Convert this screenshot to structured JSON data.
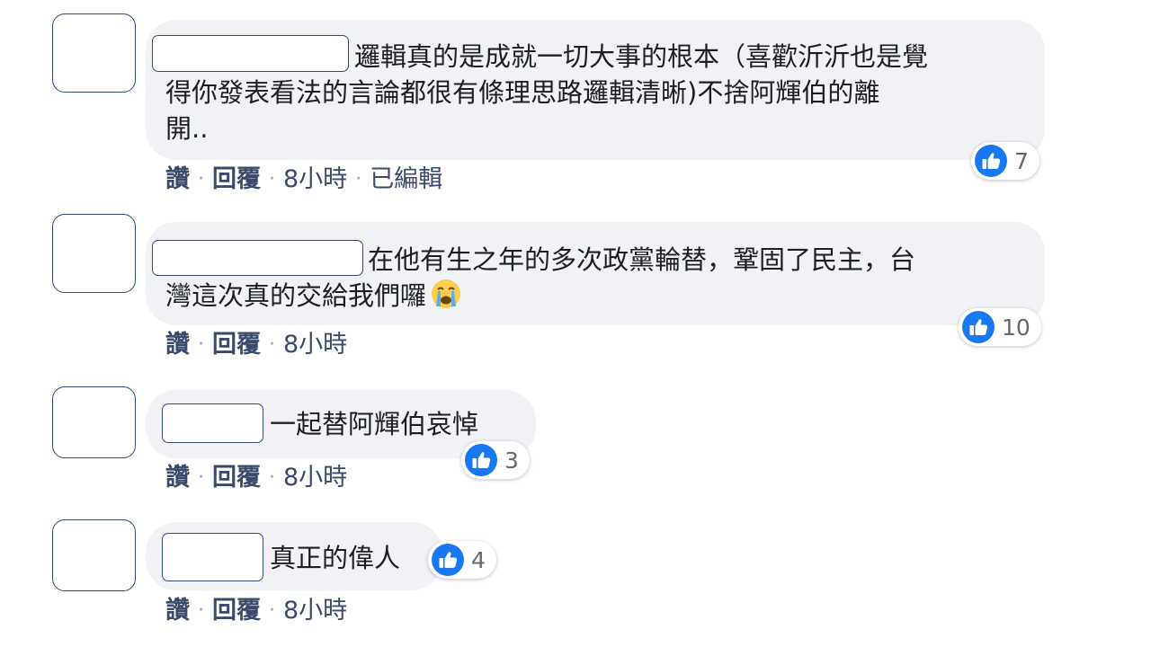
{
  "comments": [
    {
      "text_lines": [
        "邏輯真的是成就一切大事的根本（喜歡沂沂也是覺",
        "得你發表看法的言論都很有條理思路邏輯清晰)不捨阿輝伯的離",
        "開.."
      ],
      "reactions": "7",
      "like_label": "讚",
      "reply_label": "回覆",
      "time": "8小時",
      "edited": "已編輯"
    },
    {
      "text_lines": [
        "在他有生之年的多次政黨輪替，鞏固了民主，台",
        "灣這次真的交給我們囉"
      ],
      "emoji": "crying-face-emoji",
      "reactions": "10",
      "like_label": "讚",
      "reply_label": "回覆",
      "time": "8小時"
    },
    {
      "text_lines": [
        "一起替阿輝伯哀悼"
      ],
      "reactions": "3",
      "like_label": "讚",
      "reply_label": "回覆",
      "time": "8小時"
    },
    {
      "text_lines": [
        "真正的偉人"
      ],
      "reactions": "4",
      "like_label": "讚",
      "reply_label": "回覆",
      "time": "8小時"
    }
  ],
  "separator": "·",
  "icons": {
    "like": "thumbs-up-icon"
  },
  "colors": {
    "like_blue": "#1877f2",
    "bubble_bg": "#f0f2f5",
    "redaction_border": "#2f4a80"
  }
}
